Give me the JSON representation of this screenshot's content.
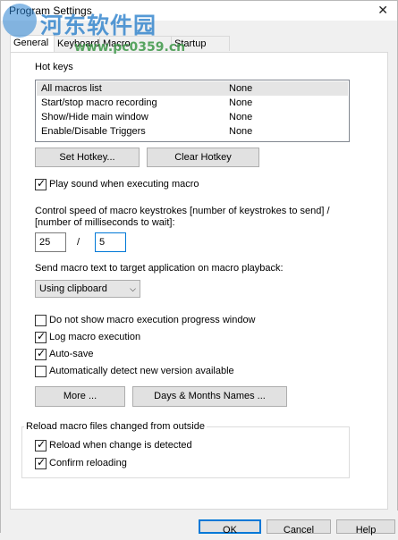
{
  "window": {
    "title": "Program Settings",
    "close_glyph": "✕"
  },
  "watermark": {
    "text": "河东软件园",
    "url": "www.pc0359.cn",
    "logo_icon": "watermark-logo"
  },
  "tabs": [
    {
      "label": "General",
      "active": true
    },
    {
      "label": "Keyboard",
      "active": false
    },
    {
      "label": "Macro Toolbars",
      "active": false
    },
    {
      "label": "Startup Files",
      "active": false
    }
  ],
  "hotkeys": {
    "section_label": "Hot keys",
    "rows": [
      {
        "action": "All macros list",
        "key": "None"
      },
      {
        "action": "Start/stop macro recording",
        "key": "None"
      },
      {
        "action": "Show/Hide main window",
        "key": "None"
      },
      {
        "action": "Enable/Disable Triggers",
        "key": "None"
      }
    ],
    "set_button": "Set Hotkey...",
    "clear_button": "Clear Hotkey"
  },
  "play_sound": {
    "label": "Play sound when executing macro",
    "checked": true
  },
  "speed": {
    "label_line1": "Control speed of macro keystrokes [number of keystrokes to send] /",
    "label_line2": "[number of milliseconds to wait]:",
    "keystrokes": "25",
    "separator": "/",
    "milliseconds": "5"
  },
  "send_mode": {
    "label": "Send macro text to target application on macro playback:",
    "selected": "Using clipboard"
  },
  "options": [
    {
      "label": "Do not show macro execution progress window",
      "checked": false
    },
    {
      "label": "Log macro execution",
      "checked": true
    },
    {
      "label": "Auto-save",
      "checked": true
    },
    {
      "label": "Automatically detect new version available",
      "checked": false
    }
  ],
  "more_button": "More ...",
  "days_button": "Days & Months Names ...",
  "reload_group": {
    "title": "Reload macro files changed from outside",
    "reload_when_changed": {
      "label": "Reload when change is detected",
      "checked": true
    },
    "confirm_reloading": {
      "label": "Confirm reloading",
      "checked": true
    }
  },
  "dialog_buttons": {
    "ok": "OK",
    "cancel": "Cancel",
    "help": "Help"
  },
  "colors": {
    "focus": "#0078d7",
    "button": "#e1e1e1",
    "selected_row": "#e5e5e5"
  }
}
